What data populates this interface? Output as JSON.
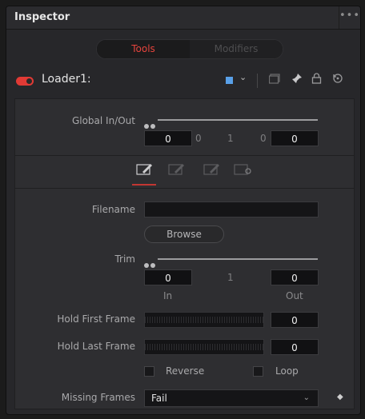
{
  "window": {
    "title": "Inspector",
    "more_label": "•••"
  },
  "tabs": {
    "active": "Tools",
    "inactive": "Modifiers"
  },
  "tool": {
    "name": "Loader1:",
    "color": "#59a0e8"
  },
  "global_inout": {
    "label": "Global In/Out",
    "in_value": "0",
    "mid_left": "0",
    "mid_center": "1",
    "mid_right": "0",
    "out_value": "0"
  },
  "file": {
    "filename_label": "Filename",
    "filename_value": "",
    "browse_label": "Browse"
  },
  "trim": {
    "label": "Trim",
    "in_value": "0",
    "center": "1",
    "out_value": "0",
    "in_label": "In",
    "out_label": "Out"
  },
  "hold_first": {
    "label": "Hold First Frame",
    "value": "0"
  },
  "hold_last": {
    "label": "Hold Last Frame",
    "value": "0"
  },
  "options": {
    "reverse_label": "Reverse",
    "loop_label": "Loop"
  },
  "missing_frames": {
    "label": "Missing Frames",
    "value": "Fail"
  }
}
